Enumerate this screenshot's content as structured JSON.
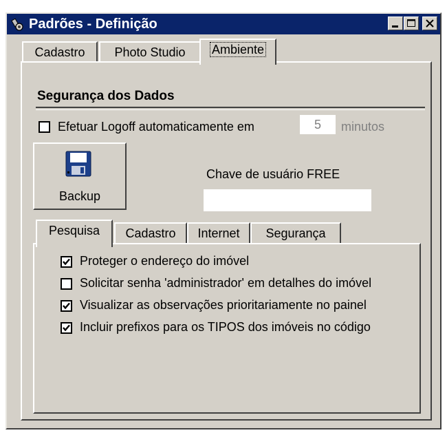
{
  "window": {
    "title": "Padrões - Definição",
    "icon": "app-icon",
    "controls": [
      "minimize-icon",
      "maximize-icon",
      "close-icon"
    ]
  },
  "main_tabs": [
    {
      "label": "Cadastro",
      "active": false
    },
    {
      "label": "Photo Studio",
      "active": false
    },
    {
      "label": "Ambiente",
      "active": true
    }
  ],
  "security_section": {
    "heading": "Segurança dos Dados",
    "logoff_label": "Efetuar Logoff automaticamente em",
    "logoff_checked": false,
    "logoff_minutes": "5",
    "minutes_label": "minutos"
  },
  "backup": {
    "label": "Backup",
    "icon": "floppy-disk-icon"
  },
  "user_key": {
    "label": "Chave de usuário FREE",
    "value": ""
  },
  "sub_tabs": [
    {
      "label": "Pesquisa",
      "active": true
    },
    {
      "label": "Cadastro",
      "active": false
    },
    {
      "label": "Internet",
      "active": false
    },
    {
      "label": "Segurança",
      "active": false
    }
  ],
  "options": [
    {
      "label": "Proteger o endereço do imóvel",
      "checked": true
    },
    {
      "label": "Solicitar senha 'administrador' em detalhes do imóvel",
      "checked": false
    },
    {
      "label": "Visualizar as observações prioritariamente no painel",
      "checked": true
    },
    {
      "label": "Incluir prefixos para os TIPOS dos imóveis no código",
      "checked": true
    }
  ]
}
